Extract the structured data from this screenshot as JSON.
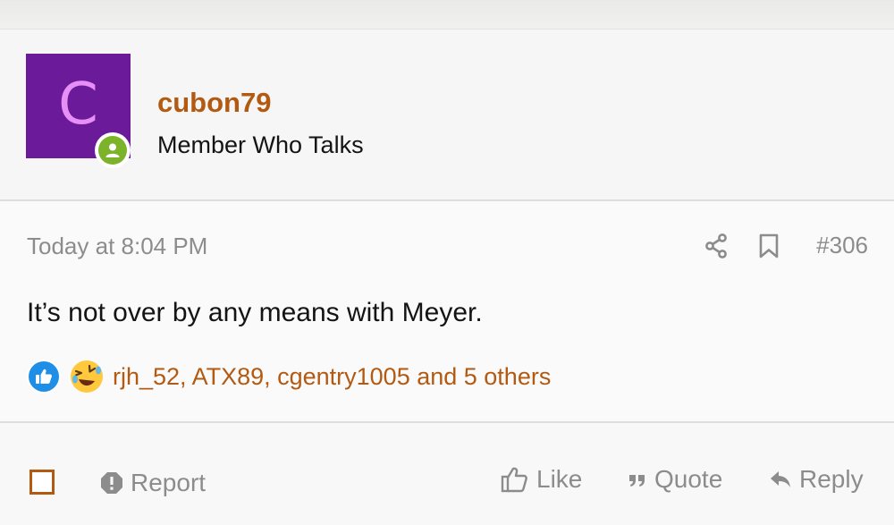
{
  "colors": {
    "accent": "#b35a12",
    "avatar_bg": "#6b1b9a",
    "avatar_letter": "#e88ef7",
    "online": "#7cb32a",
    "muted": "#8c8c8c"
  },
  "user": {
    "avatar_letter": "C",
    "username": "cubon79",
    "title": "Member Who Talks",
    "status_icon": "user-online-icon"
  },
  "post": {
    "timestamp": "Today at 8:04 PM",
    "number": "#306",
    "message": "It’s not over by any means with Meyer.",
    "share_icon": "share-icon",
    "bookmark_icon": "bookmark-icon"
  },
  "reactions": {
    "icons": [
      "like-reaction-icon",
      "haha-reaction-icon"
    ],
    "users_text": "rjh_52, ATX89, cgentry1005 and 5 others"
  },
  "footer": {
    "report_label": "Report",
    "like_label": "Like",
    "quote_label": "Quote",
    "reply_label": "Reply"
  }
}
